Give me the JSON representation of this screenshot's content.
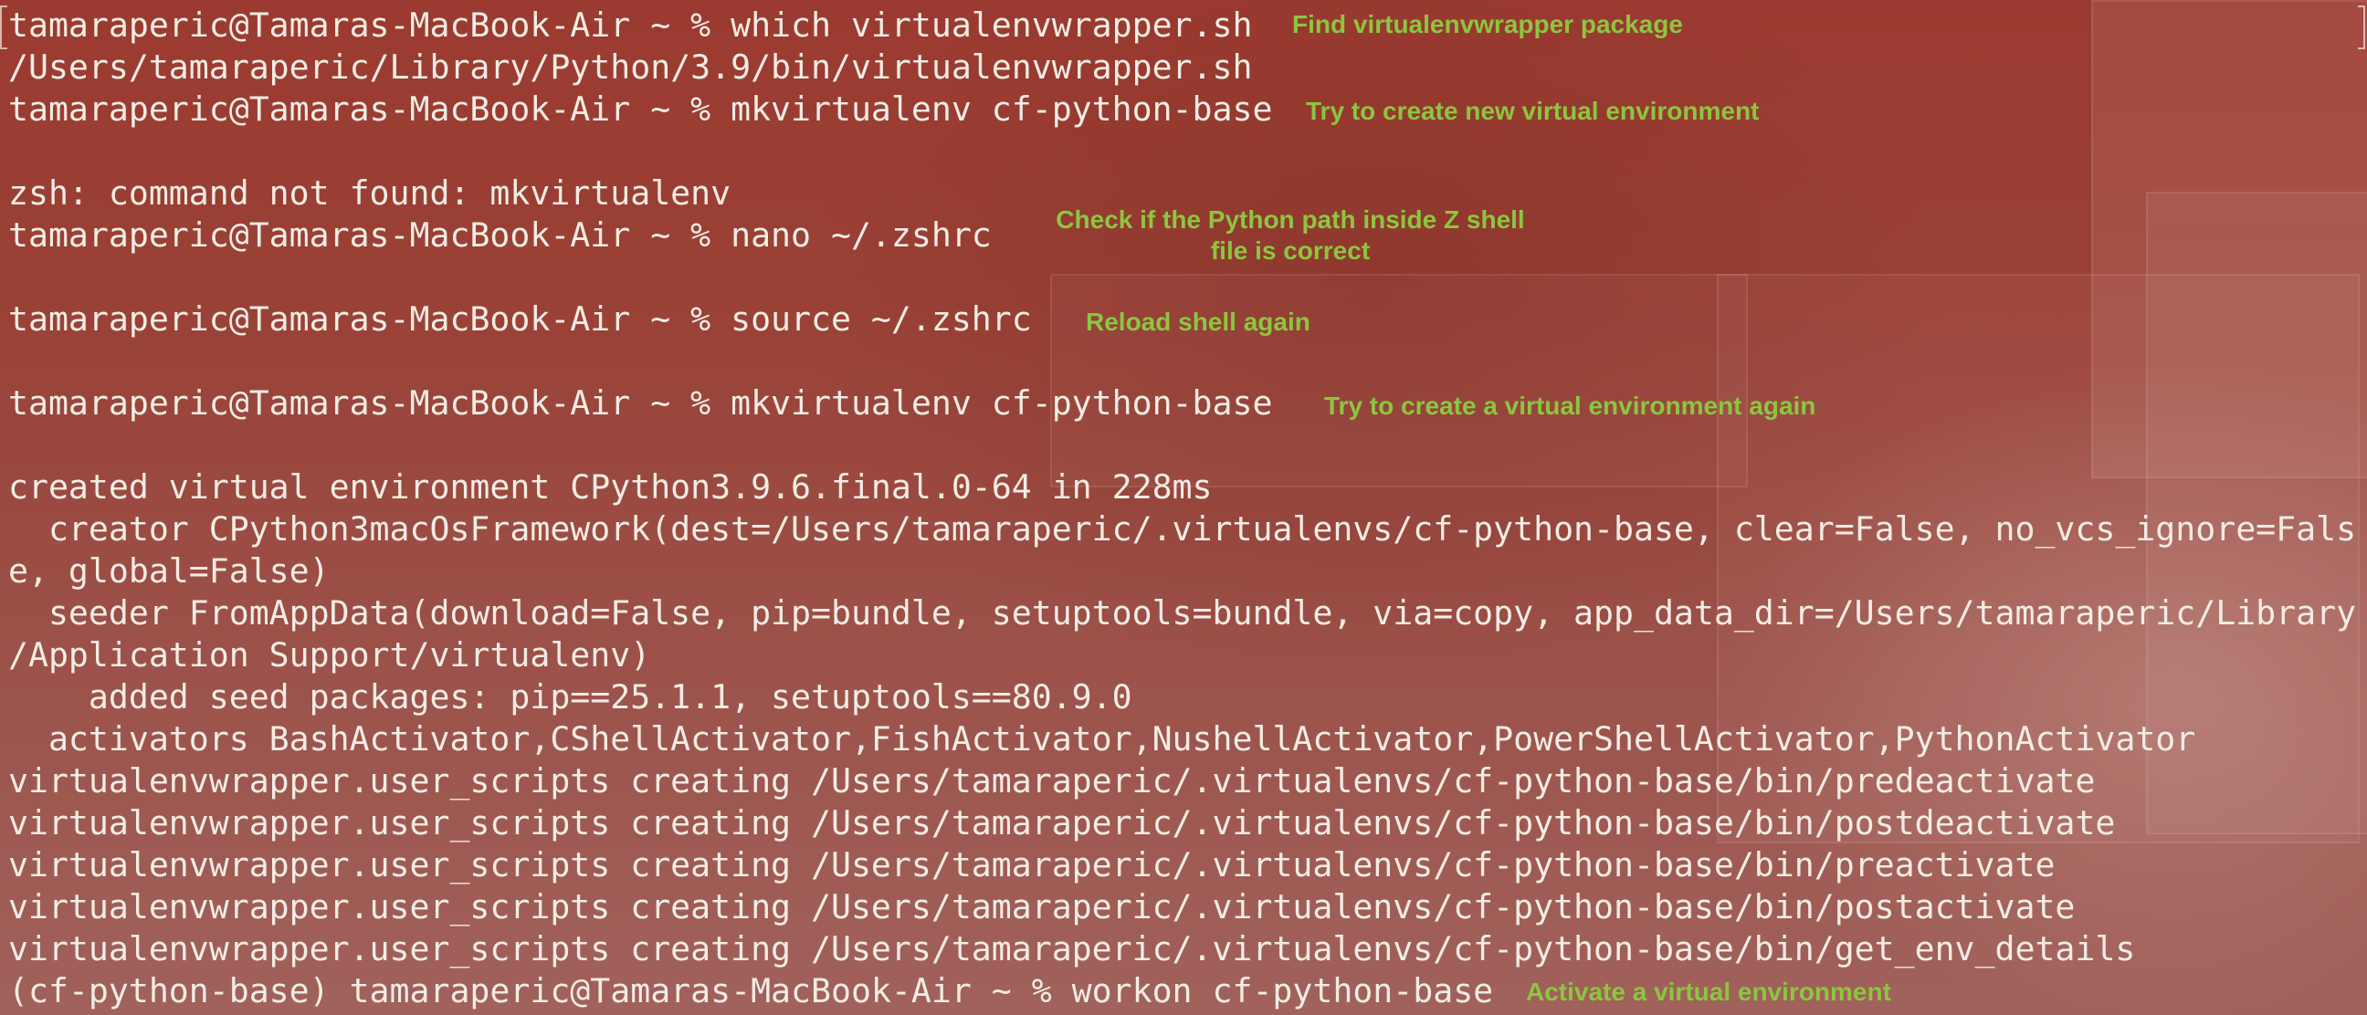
{
  "terminal": {
    "lines": [
      "tamaraperic@Tamaras-MacBook-Air ~ % which virtualenvwrapper.sh",
      "/Users/tamaraperic/Library/Python/3.9/bin/virtualenvwrapper.sh",
      "tamaraperic@Tamaras-MacBook-Air ~ % mkvirtualenv cf-python-base",
      "zsh: command not found: mkvirtualenv",
      "tamaraperic@Tamaras-MacBook-Air ~ % nano ~/.zshrc",
      "tamaraperic@Tamaras-MacBook-Air ~ % source ~/.zshrc",
      "tamaraperic@Tamaras-MacBook-Air ~ % mkvirtualenv cf-python-base",
      "created virtual environment CPython3.9.6.final.0-64 in 228ms",
      "  creator CPython3macOsFramework(dest=/Users/tamaraperic/.virtualenvs/cf-python-base, clear=False, no_vcs_ignore=Fals",
      "e, global=False)",
      "  seeder FromAppData(download=False, pip=bundle, setuptools=bundle, via=copy, app_data_dir=/Users/tamaraperic/Library",
      "/Application Support/virtualenv)",
      "    added seed packages: pip==25.1.1, setuptools==80.9.0",
      "  activators BashActivator,CShellActivator,FishActivator,NushellActivator,PowerShellActivator,PythonActivator",
      "virtualenvwrapper.user_scripts creating /Users/tamaraperic/.virtualenvs/cf-python-base/bin/predeactivate",
      "virtualenvwrapper.user_scripts creating /Users/tamaraperic/.virtualenvs/cf-python-base/bin/postdeactivate",
      "virtualenvwrapper.user_scripts creating /Users/tamaraperic/.virtualenvs/cf-python-base/bin/preactivate",
      "virtualenvwrapper.user_scripts creating /Users/tamaraperic/.virtualenvs/cf-python-base/bin/postactivate",
      "virtualenvwrapper.user_scripts creating /Users/tamaraperic/.virtualenvs/cf-python-base/bin/get_env_details",
      "(cf-python-base) tamaraperic@Tamaras-MacBook-Air ~ % workon cf-python-base"
    ]
  },
  "annotations": [
    "Find virtualenvwrapper package",
    "Try to create new virtual environment",
    "Check if the Python path inside Z shell",
    "file is correct",
    "Reload shell again",
    "Try to create a virtual environment again",
    "Activate a virtual environment"
  ],
  "colors": {
    "background": "#9c4a3f",
    "terminal_text": "#f2ece4",
    "annotation_text": "#8cc63f"
  }
}
